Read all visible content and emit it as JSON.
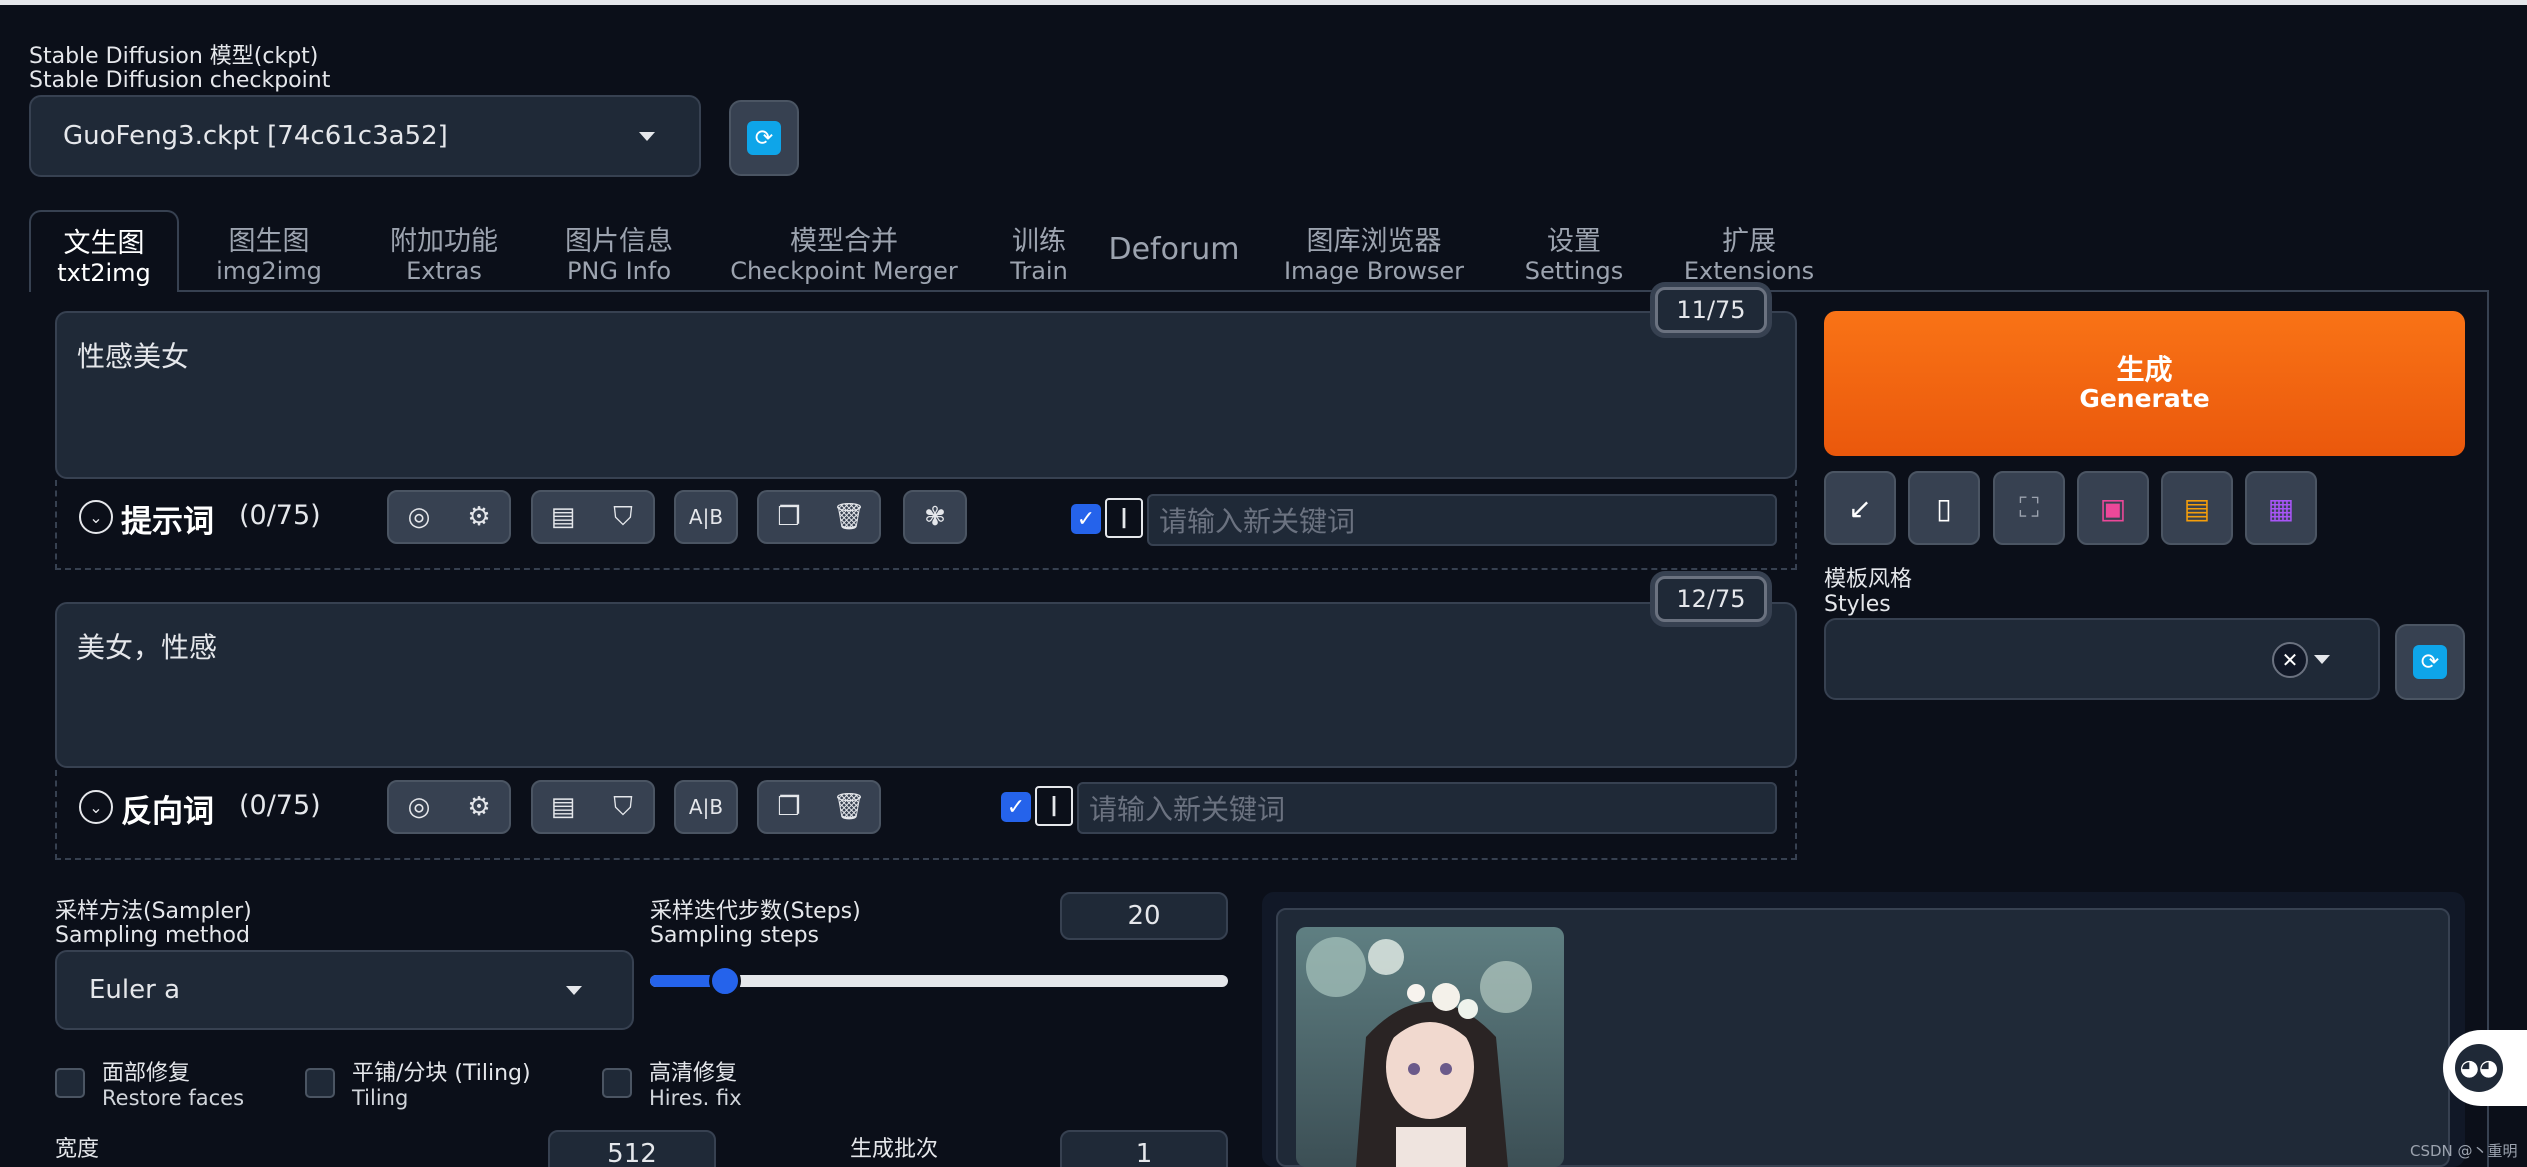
{
  "checkpoint": {
    "label_cn": "Stable Diffusion 模型(ckpt)",
    "label_en": "Stable Diffusion checkpoint",
    "value": "GuoFeng3.ckpt [74c61c3a52]"
  },
  "tabs": [
    {
      "cn": "文生图",
      "en": "txt2img",
      "active": true
    },
    {
      "cn": "图生图",
      "en": "img2img"
    },
    {
      "cn": "附加功能",
      "en": "Extras"
    },
    {
      "cn": "图片信息",
      "en": "PNG Info"
    },
    {
      "cn": "模型合并",
      "en": "Checkpoint Merger"
    },
    {
      "cn": "训练",
      "en": "Train"
    },
    {
      "cn": "Deforum",
      "en": ""
    },
    {
      "cn": "图库浏览器",
      "en": "Image Browser"
    },
    {
      "cn": "设置",
      "en": "Settings"
    },
    {
      "cn": "扩展",
      "en": "Extensions"
    }
  ],
  "prompt": {
    "text": "性感美女",
    "counter": "11/75",
    "title": "提示词",
    "count": "(0/75)",
    "keyword_placeholder": "请输入新关键词"
  },
  "negative": {
    "text": "美女，性感",
    "counter": "12/75",
    "title": "反向词",
    "count": "(0/75)",
    "keyword_placeholder": "请输入新关键词"
  },
  "generate": {
    "cn": "生成",
    "en": "Generate"
  },
  "styles": {
    "label_cn": "模板风格",
    "label_en": "Styles"
  },
  "sampler": {
    "label_cn": "采样方法(Sampler)",
    "label_en": "Sampling method",
    "value": "Euler a"
  },
  "steps": {
    "label_cn": "采样迭代步数(Steps)",
    "label_en": "Sampling steps",
    "value": "20",
    "fraction": 0.13
  },
  "options": [
    {
      "cn": "面部修复",
      "en": "Restore faces"
    },
    {
      "cn": "平铺/分块 (Tiling)",
      "en": "Tiling"
    },
    {
      "cn": "高清修复",
      "en": "Hires. fix"
    }
  ],
  "width": {
    "label": "宽度",
    "value": "512"
  },
  "batch_count": {
    "label": "生成批次",
    "value": "1"
  },
  "watermark": "CSDN @丶重明",
  "colors": {
    "accent": "#f97316",
    "primary": "#2563eb",
    "bg": "#0b0f19"
  }
}
